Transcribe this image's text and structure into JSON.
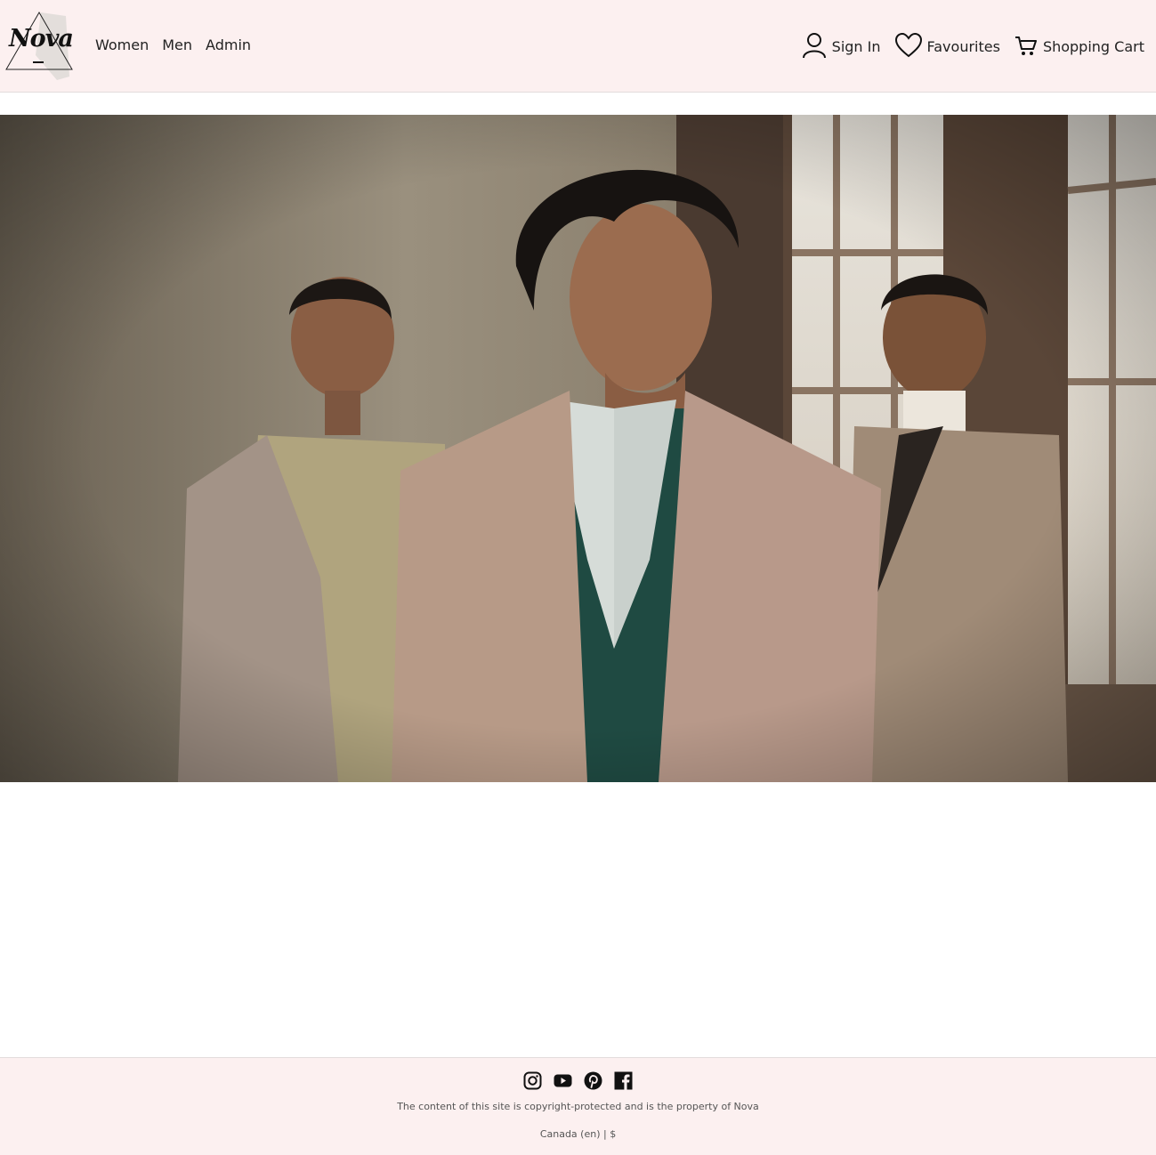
{
  "brand": {
    "logo_text": "Nova"
  },
  "nav": {
    "items": [
      {
        "label": "Women"
      },
      {
        "label": "Men"
      },
      {
        "label": "Admin"
      }
    ]
  },
  "actions": {
    "sign_in": {
      "label": "Sign In",
      "icon": "user-icon"
    },
    "favourites": {
      "label": "Favourites",
      "icon": "heart-icon"
    },
    "cart": {
      "label": "Shopping Cart",
      "icon": "cart-icon"
    }
  },
  "hero": {
    "image": "hero-photo"
  },
  "footer": {
    "social": [
      {
        "icon": "instagram-icon"
      },
      {
        "icon": "youtube-icon"
      },
      {
        "icon": "pinterest-icon"
      },
      {
        "icon": "facebook-icon"
      }
    ],
    "copyright": "The content of this site is copyright-protected and is the property of Nova",
    "locale": "Canada (en) | $"
  },
  "colors": {
    "header_bg": "#fcf0f0",
    "footer_bg": "#fcf0f0",
    "text": "#222222"
  }
}
